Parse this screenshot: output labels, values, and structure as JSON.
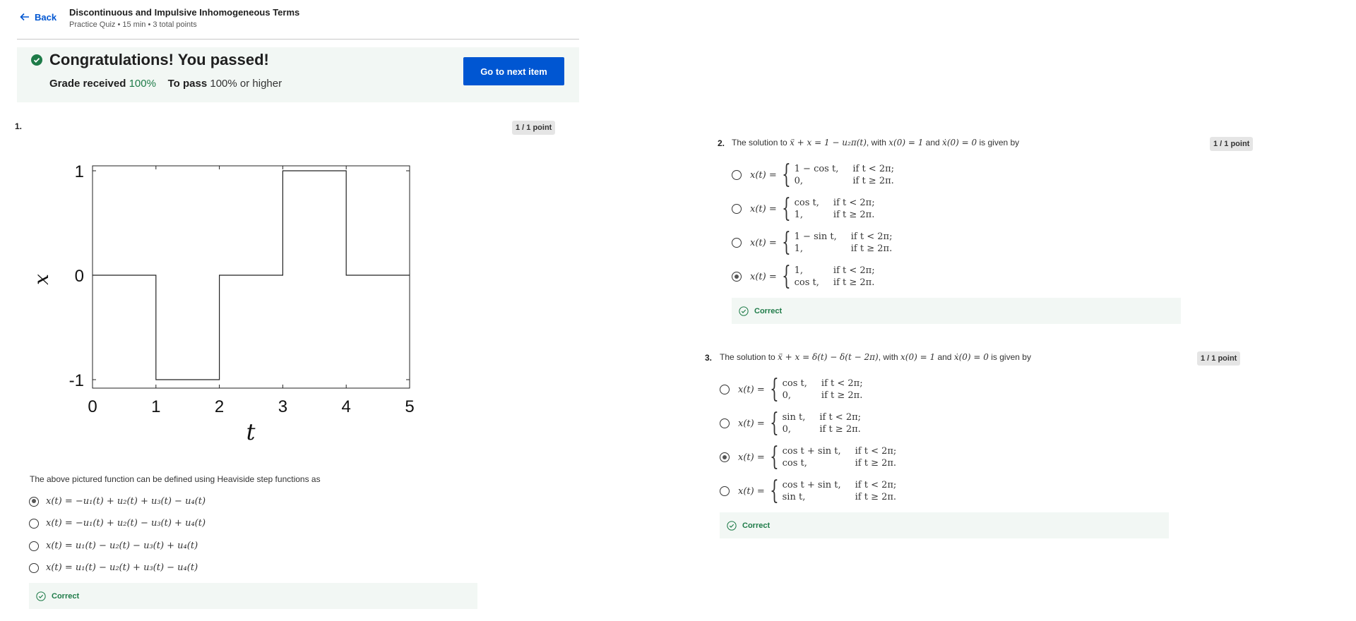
{
  "header": {
    "back_label": "Back",
    "title": "Discontinuous and Impulsive Inhomogeneous Terms",
    "subtitle": "Practice Quiz • 15 min • 3 total points"
  },
  "result": {
    "heading": "Congratulations! You passed!",
    "grade_label": "Grade received",
    "grade_value": "100%",
    "pass_label": "To pass",
    "pass_value": "100% or higher",
    "next_button": "Go to next item",
    "accent_color": "#1e7b48",
    "button_color": "#0056d2"
  },
  "questions": [
    {
      "number": "1.",
      "points": "1 / 1 point",
      "prompt": "The above pictured function can be defined using Heaviside step functions as",
      "options": [
        {
          "text": "x(t) = −u₁(t) + u₂(t) + u₃(t) − u₄(t)",
          "selected": true
        },
        {
          "text": "x(t) = −u₁(t) + u₂(t) − u₃(t) + u₄(t)",
          "selected": false
        },
        {
          "text": "x(t) = u₁(t) − u₂(t) − u₃(t) + u₄(t)",
          "selected": false
        },
        {
          "text": "x(t) = u₁(t) − u₂(t) + u₃(t) − u₄(t)",
          "selected": false
        }
      ],
      "feedback": "Correct"
    },
    {
      "number": "2.",
      "points": "1 / 1 point",
      "prompt_pre": "The solution to ",
      "prompt_eq1": "ẍ + x = 1 − u₂π(t)",
      "prompt_mid1": ", with ",
      "prompt_eq2": "x(0) = 1",
      "prompt_mid2": " and ",
      "prompt_eq3": "ẋ(0) = 0",
      "prompt_post": " is given by",
      "options": [
        {
          "lhs": "x(t) =",
          "r1a": "1 − cos t,",
          "r1b": "if t < 2π;",
          "r2a": "0,",
          "r2b": "if t ≥ 2π.",
          "selected": false
        },
        {
          "lhs": "x(t) =",
          "r1a": "cos t,",
          "r1b": "if t < 2π;",
          "r2a": "1,",
          "r2b": "if t ≥ 2π.",
          "selected": false
        },
        {
          "lhs": "x(t) =",
          "r1a": "1 − sin t,",
          "r1b": "if t < 2π;",
          "r2a": "1,",
          "r2b": "if t ≥ 2π.",
          "selected": false
        },
        {
          "lhs": "x(t) =",
          "r1a": "1,",
          "r1b": "if t < 2π;",
          "r2a": "cos t,",
          "r2b": "if t ≥ 2π.",
          "selected": true
        }
      ],
      "feedback": "Correct"
    },
    {
      "number": "3.",
      "points": "1 / 1 point",
      "prompt_pre": "The solution to ",
      "prompt_eq1": "ẍ + x = δ(t) − δ(t − 2π)",
      "prompt_mid1": ", with ",
      "prompt_eq2": "x(0) = 1",
      "prompt_mid2": " and ",
      "prompt_eq3": "ẋ(0) = 0",
      "prompt_post": " is given by",
      "options": [
        {
          "lhs": "x(t) =",
          "r1a": "cos t,",
          "r1b": "if t < 2π;",
          "r2a": "0,",
          "r2b": "if t ≥ 2π.",
          "selected": false
        },
        {
          "lhs": "x(t) =",
          "r1a": "sin t,",
          "r1b": "if t < 2π;",
          "r2a": "0,",
          "r2b": "if t ≥ 2π.",
          "selected": false
        },
        {
          "lhs": "x(t) =",
          "r1a": "cos t + sin t,",
          "r1b": "if t < 2π;",
          "r2a": "cos t,",
          "r2b": "if t ≥ 2π.",
          "selected": true
        },
        {
          "lhs": "x(t) =",
          "r1a": "cos t + sin t,",
          "r1b": "if t < 2π;",
          "r2a": "sin t,",
          "r2b": "if t ≥ 2π.",
          "selected": false
        }
      ],
      "feedback": "Correct"
    }
  ],
  "chart_data": {
    "type": "line",
    "step": true,
    "x": [
      0,
      1,
      1,
      2,
      2,
      3,
      3,
      4,
      4,
      5
    ],
    "y": [
      0,
      0,
      -1,
      -1,
      0,
      0,
      1,
      1,
      0,
      0
    ],
    "xlabel": "t",
    "ylabel": "x",
    "xlim": [
      0,
      5
    ],
    "ylim": [
      -1,
      1
    ],
    "xticks": [
      "0",
      "1",
      "2",
      "3",
      "4",
      "5"
    ],
    "yticks": [
      "-1",
      "0",
      "1"
    ],
    "grid": false
  }
}
